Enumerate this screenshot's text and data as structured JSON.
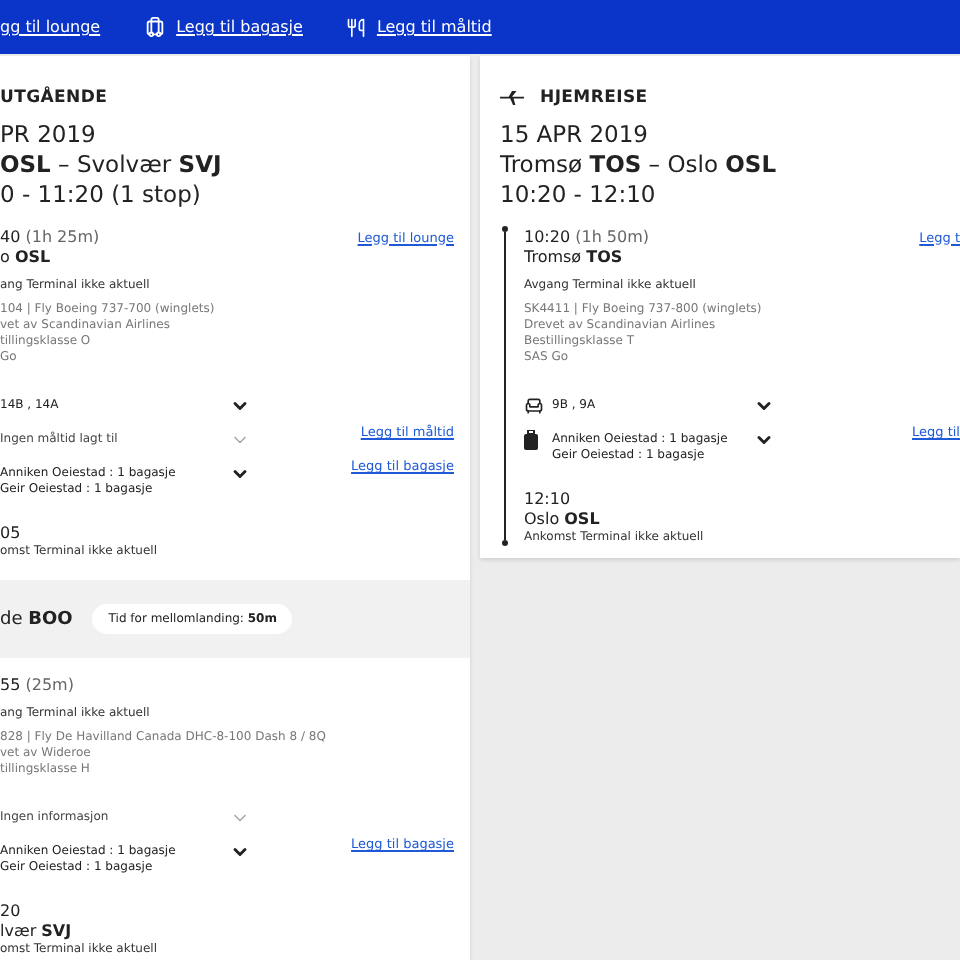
{
  "top_bar": {
    "links": [
      {
        "label": "gg til lounge"
      },
      {
        "label": "Legg til bagasje"
      },
      {
        "label": "Legg til måltid"
      }
    ]
  },
  "trips": [
    {
      "title": "UTGÅENDE",
      "date": "PR 2019",
      "route": "**OSL** – Svolvær **SVJ**",
      "times": "0 - 11:20 (1 stop)",
      "parts": [
        {
          "kind": "segment",
          "departure_time": "40",
          "duration": "(1h 25m)",
          "departure_airport": "o **OSL**",
          "lounge_link": "Legg til lounge",
          "departure_terminal": "ang Terminal ikke aktuell",
          "details": [
            "104 | Fly Boeing 737-700 (winglets)",
            "vet av Scandinavian Airlines",
            "tillingsklasse O",
            "Go"
          ],
          "services": [
            {
              "lines": [
                "14B , 14A"
              ],
              "disabled": false
            },
            {
              "lines": [
                "Ingen måltid lagt til"
              ],
              "disabled": true,
              "link": "Legg til måltid"
            },
            {
              "lines": [
                "Anniken Oeiestad : 1 bagasje",
                "Geir Oeiestad : 1 bagasje"
              ],
              "disabled": false,
              "link": "Legg til bagasje"
            }
          ],
          "arrival_time": "05",
          "arrival_terminal": "omst Terminal ikke aktuell"
        },
        {
          "kind": "layover",
          "place": "de **BOO**",
          "badge": "Tid for mellomlanding: **50m**"
        },
        {
          "kind": "segment",
          "departure_time": "55",
          "duration": "(25m)",
          "departure_terminal": "ang Terminal ikke aktuell",
          "details": [
            "828 | Fly De Havilland Canada DHC-8-100 Dash 8 / 8Q",
            "vet av Wideroe",
            "tillingsklasse H"
          ],
          "services": [
            {
              "lines": [
                "Ingen informasjon"
              ],
              "disabled": true
            },
            {
              "lines": [
                "Anniken Oeiestad : 1 bagasje",
                "Geir Oeiestad : 1 bagasje"
              ],
              "disabled": false,
              "link": "Legg til bagasje"
            }
          ],
          "arrival_time": "20",
          "arrival_airport": "lvær **SVJ**",
          "arrival_terminal": "omst Terminal ikke aktuell"
        }
      ]
    },
    {
      "title": "HJEMREISE",
      "date": "15 APR 2019",
      "route": "Tromsø **TOS** – Oslo **OSL**",
      "times": "10:20 - 12:10",
      "parts": [
        {
          "kind": "segment",
          "departure_time": "10:20",
          "duration": "(1h 50m)",
          "departure_airport": "Tromsø **TOS**",
          "lounge_link": "Legg t",
          "departure_terminal": "Avgang Terminal ikke aktuell",
          "details": [
            "SK4411 | Fly Boeing 737-800 (winglets)",
            "Drevet av Scandinavian Airlines",
            "Bestillingsklasse T",
            "SAS Go"
          ],
          "services": [
            {
              "kind": "seat",
              "lines": [
                "9B , 9A"
              ],
              "disabled": false
            },
            {
              "kind": "baggage",
              "lines": [
                "Anniken Oeiestad : 1 bagasje",
                "Geir Oeiestad : 1 bagasje"
              ],
              "disabled": false,
              "link": "Legg til"
            }
          ],
          "arrival_time": "12:10",
          "arrival_airport": "Oslo **OSL**",
          "arrival_terminal": "Ankomst Terminal ikke aktuell"
        }
      ]
    }
  ]
}
